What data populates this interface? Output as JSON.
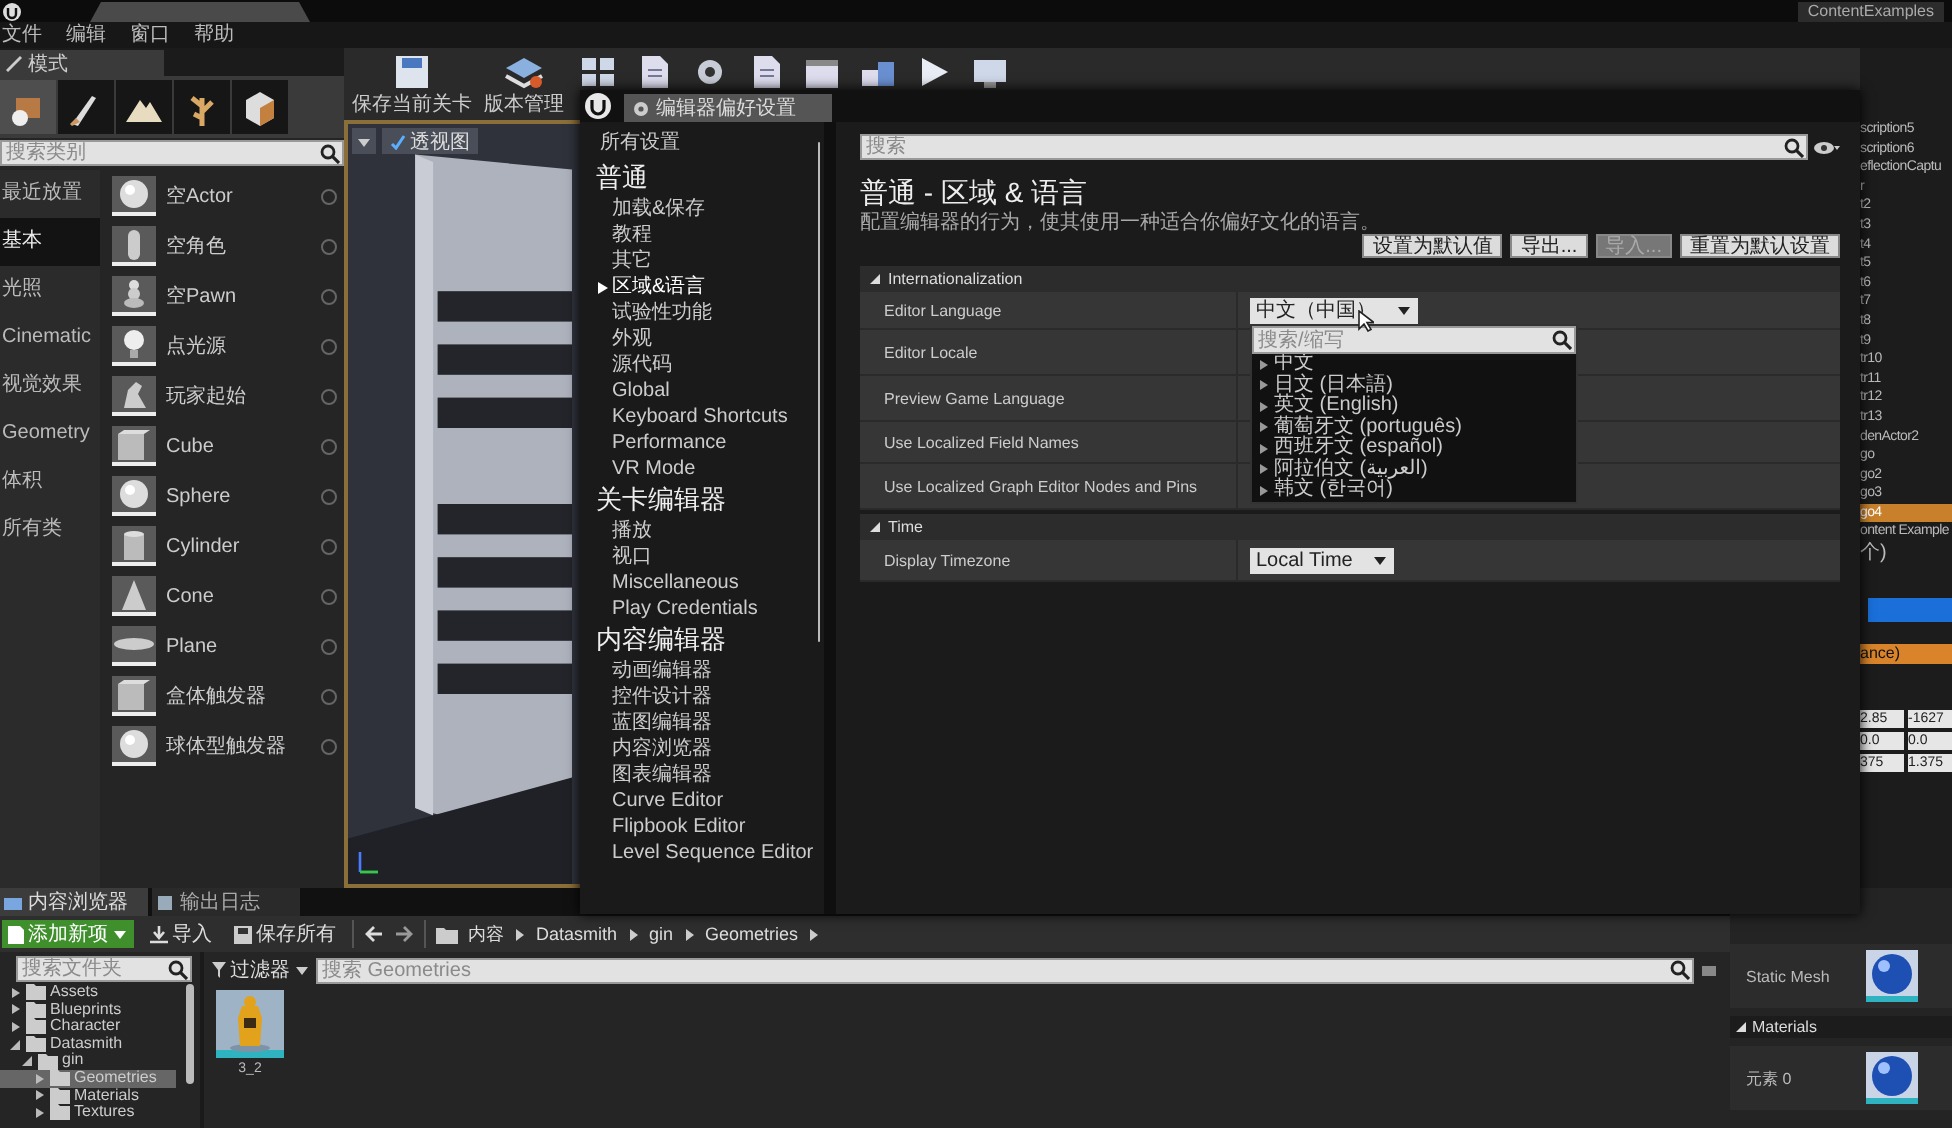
{
  "title_bar": {
    "project": "ContentExamples"
  },
  "menu": [
    "文件",
    "编辑",
    "窗口",
    "帮助"
  ],
  "modes_panel": {
    "tab": "模式",
    "search": {
      "placeholder": "搜索类别"
    },
    "categories": [
      {
        "label": "最近放置",
        "selected": false
      },
      {
        "label": "基本",
        "selected": true
      },
      {
        "label": "光照",
        "selected": false
      },
      {
        "label": "Cinematic",
        "selected": false
      },
      {
        "label": "视觉效果",
        "selected": false
      },
      {
        "label": "Geometry",
        "selected": false
      },
      {
        "label": "体积",
        "selected": false
      },
      {
        "label": "所有类",
        "selected": false
      }
    ],
    "items": [
      {
        "label": "空Actor",
        "kind": "sphere"
      },
      {
        "label": "空角色",
        "kind": "capsule"
      },
      {
        "label": "空Pawn",
        "kind": "pawn"
      },
      {
        "label": "点光源",
        "kind": "bulb"
      },
      {
        "label": "玩家起始",
        "kind": "player"
      },
      {
        "label": "Cube",
        "kind": "cube"
      },
      {
        "label": "Sphere",
        "kind": "sphere"
      },
      {
        "label": "Cylinder",
        "kind": "cylinder"
      },
      {
        "label": "Cone",
        "kind": "cone"
      },
      {
        "label": "Plane",
        "kind": "plane"
      },
      {
        "label": "盒体触发器",
        "kind": "cube"
      },
      {
        "label": "球体型触发器",
        "kind": "sphere"
      }
    ]
  },
  "toolbar": [
    {
      "kind": "save",
      "label": "保存当前关卡"
    },
    {
      "kind": "source",
      "label": "版本管理"
    },
    {
      "kind": "content"
    },
    {
      "kind": "page"
    },
    {
      "kind": "settings"
    },
    {
      "kind": "page"
    },
    {
      "kind": "cinematics"
    },
    {
      "kind": "build"
    },
    {
      "kind": "play"
    },
    {
      "kind": "launch"
    }
  ],
  "viewport": {
    "buttons": [
      {
        "label": "透视图"
      }
    ]
  },
  "outliner": {
    "items": [
      {
        "label": "scription5",
        "selected": false
      },
      {
        "label": "scription6",
        "selected": false
      },
      {
        "label": "eflectionCaptu",
        "selected": false
      },
      {
        "label": "r",
        "selected": false
      },
      {
        "label": "t2",
        "selected": false
      },
      {
        "label": "t3",
        "selected": false
      },
      {
        "label": "t4",
        "selected": false
      },
      {
        "label": "t5",
        "selected": false
      },
      {
        "label": "t6",
        "selected": false
      },
      {
        "label": "t7",
        "selected": false
      },
      {
        "label": "t8",
        "selected": false
      },
      {
        "label": "t9",
        "selected": false
      },
      {
        "label": "tr10",
        "selected": false
      },
      {
        "label": "tr11",
        "selected": false
      },
      {
        "label": "tr12",
        "selected": false
      },
      {
        "label": "tr13",
        "selected": false
      },
      {
        "label": "denActor2",
        "selected": false
      },
      {
        "label": "go",
        "selected": false
      },
      {
        "label": "go2",
        "selected": false
      },
      {
        "label": "go3",
        "selected": false
      },
      {
        "label": "go4",
        "selected": true
      },
      {
        "label": "ontent Example",
        "selected": false
      }
    ],
    "count": "个)"
  },
  "side_details": {
    "highlight": "ance)",
    "values": [
      "2.85",
      "-1627",
      "0.0",
      "0.0",
      "375",
      "1.375"
    ]
  },
  "preferences_window": {
    "title": "编辑器偏好设置",
    "nav_all": "所有设置",
    "nav_groups": [
      {
        "heading": "普通",
        "items": [
          {
            "label": "加载&保存",
            "selected": false
          },
          {
            "label": "教程",
            "selected": false
          },
          {
            "label": "其它",
            "selected": false
          },
          {
            "label": "区域&语言",
            "selected": true
          },
          {
            "label": "试验性功能",
            "selected": false
          },
          {
            "label": "外观",
            "selected": false
          },
          {
            "label": "源代码",
            "selected": false
          },
          {
            "label": "Global",
            "selected": false
          },
          {
            "label": "Keyboard Shortcuts",
            "selected": false
          },
          {
            "label": "Performance",
            "selected": false
          },
          {
            "label": "VR Mode",
            "selected": false
          }
        ]
      },
      {
        "heading": "关卡编辑器",
        "items": [
          {
            "label": "播放",
            "selected": false
          },
          {
            "label": "视口",
            "selected": false
          },
          {
            "label": "Miscellaneous",
            "selected": false
          },
          {
            "label": "Play Credentials",
            "selected": false
          }
        ]
      },
      {
        "heading": "内容编辑器",
        "items": [
          {
            "label": "动画编辑器",
            "selected": false
          },
          {
            "label": "控件设计器",
            "selected": false
          },
          {
            "label": "蓝图编辑器",
            "selected": false
          },
          {
            "label": "内容浏览器",
            "selected": false
          },
          {
            "label": "图表编辑器",
            "selected": false
          },
          {
            "label": "Curve Editor",
            "selected": false
          },
          {
            "label": "Flipbook Editor",
            "selected": false
          },
          {
            "label": "Level Sequence Editor",
            "selected": false
          }
        ]
      }
    ],
    "search": {
      "placeholder": "搜索"
    },
    "heading": "普通 - 区域 & 语言",
    "description": "配置编辑器的行为，使其使用一种适合你偏好文化的语言。",
    "buttons": [
      {
        "label": "设置为默认值",
        "disabled": false
      },
      {
        "label": "导出...",
        "disabled": false
      },
      {
        "label": "导入...",
        "disabled": true
      },
      {
        "label": "重置为默认设置",
        "disabled": false
      }
    ],
    "sections": [
      {
        "title": "Internationalization",
        "expanded": true,
        "rows": [
          {
            "label": "Editor Language",
            "value": "中文（中国）",
            "popup": {
              "search": {
                "placeholder": "搜索/缩写"
              },
              "options": [
                "中文",
                "日文 (日本語)",
                "英文 (English)",
                "葡萄牙文 (português)",
                "西班牙文 (español)",
                "阿拉伯文 (العربية)",
                "韩文 (한국어)"
              ]
            }
          },
          {
            "label": "Editor Locale"
          },
          {
            "label": "Preview Game Language"
          },
          {
            "label": "Use Localized Field Names"
          },
          {
            "label": "Use Localized Graph Editor Nodes and Pins"
          }
        ]
      },
      {
        "title": "Time",
        "expanded": true,
        "rows": [
          {
            "label": "Display Timezone",
            "value": "Local Time"
          }
        ]
      }
    ]
  },
  "content_browser": {
    "tabs": [
      {
        "label": "内容浏览器",
        "selected": true
      },
      {
        "label": "输出日志",
        "selected": false
      }
    ],
    "add_button": "添加新项",
    "import_button": "导入",
    "save_button": "保存所有",
    "breadcrumb": [
      "内容",
      "Datasmith",
      "gin",
      "Geometries"
    ],
    "folder_search": {
      "placeholder": "搜索文件夹"
    },
    "filter_button": "过滤器",
    "asset_search": {
      "placeholder": "搜索 Geometries"
    },
    "tree": [
      {
        "label": "Assets",
        "expanded": false,
        "selected": false
      },
      {
        "label": "Blueprints",
        "expanded": false,
        "selected": false
      },
      {
        "label": "Character",
        "expanded": false,
        "selected": false
      },
      {
        "label": "Datasmith",
        "expanded": true,
        "selected": false,
        "children": [
          {
            "label": "gin",
            "expanded": true,
            "selected": false,
            "children": [
              {
                "label": "Geometries",
                "expanded": false,
                "selected": true
              },
              {
                "label": "Materials",
                "expanded": false,
                "selected": false
              },
              {
                "label": "Textures",
                "expanded": false,
                "selected": false
              }
            ]
          }
        ]
      }
    ],
    "assets": [
      {
        "label": "3_2",
        "kind": "picture"
      }
    ]
  },
  "mesh_details": {
    "static_mesh_label": "Static Mesh",
    "section": "Materials",
    "section_expanded": true,
    "element_label": "元素 0"
  }
}
